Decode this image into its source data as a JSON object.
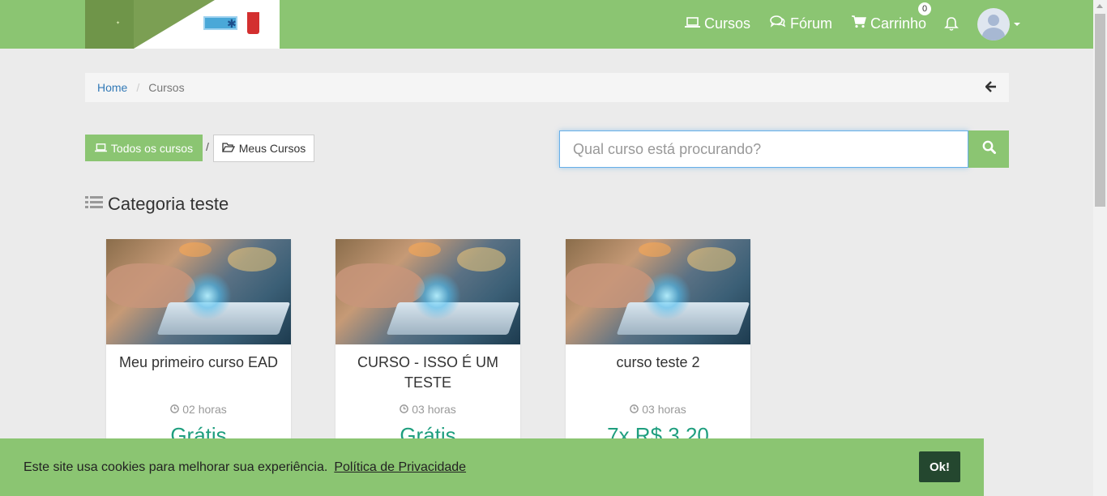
{
  "header": {
    "nav": {
      "courses": "Cursos",
      "forum": "Fórum",
      "cart": "Carrinho",
      "cart_count": "0"
    }
  },
  "breadcrumb": {
    "home": "Home",
    "current": "Cursos"
  },
  "filters": {
    "all_courses": "Todos os cursos",
    "separator": "/",
    "my_courses": "Meus Cursos"
  },
  "search": {
    "placeholder": "Qual curso está procurando?"
  },
  "category": {
    "title": "Categoria teste"
  },
  "courses": [
    {
      "title": "Meu primeiro curso EAD",
      "hours": "02 horas",
      "price": "Grátis"
    },
    {
      "title": "CURSO - ISSO É UM TESTE",
      "hours": "03 horas",
      "price": "Grátis"
    },
    {
      "title": "curso teste 2",
      "hours": "03 horas",
      "price": "7x R$ 3,20"
    }
  ],
  "cookie": {
    "message": "Este site usa cookies para melhorar sua experiência.",
    "link": "Política de Privacidade",
    "ok": "Ok!"
  },
  "colors": {
    "brand_green": "#8bc572",
    "price_green": "#1e9e7e",
    "cookie_button": "#24472f",
    "link_blue": "#337ab7"
  },
  "icons": {
    "courses": "laptop-icon",
    "forum": "comments-icon",
    "cart": "shopping-cart-icon",
    "notifications": "bell-icon",
    "back": "arrow-left-icon",
    "search": "search-icon",
    "category": "list-icon",
    "hours": "clock-icon",
    "my_courses": "folder-open-icon"
  }
}
